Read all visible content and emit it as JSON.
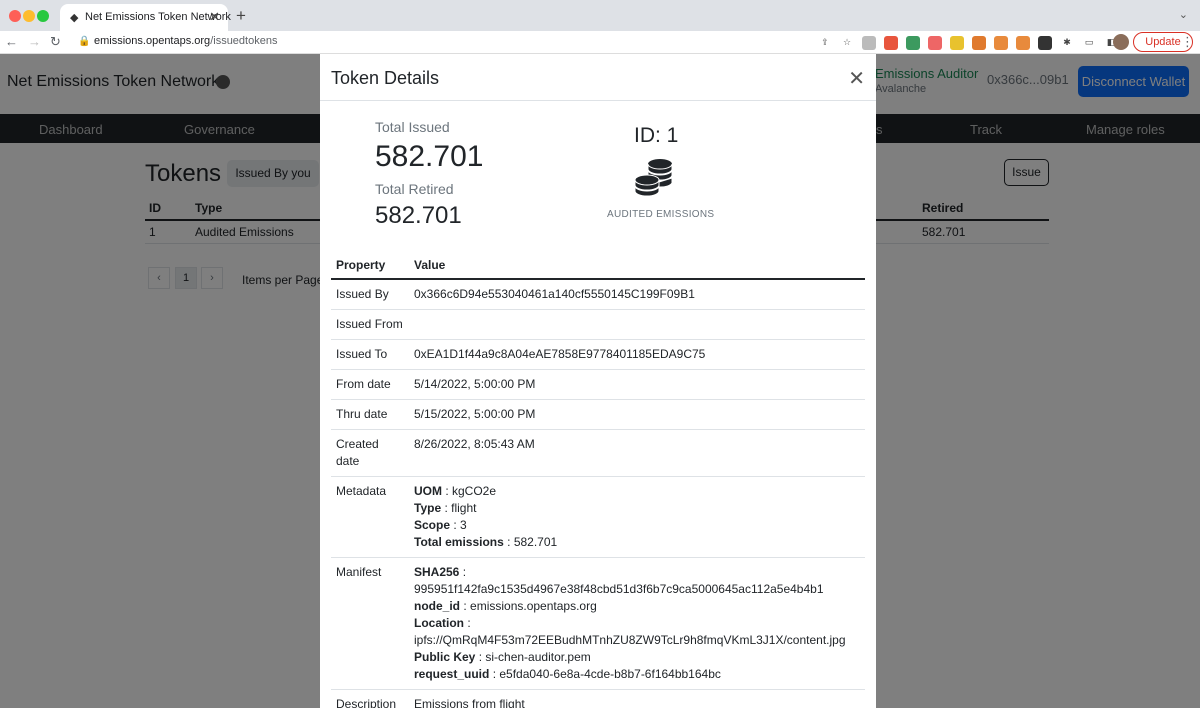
{
  "browser": {
    "tab_title": "Net Emissions Token Network",
    "url_host": "emissions.opentaps.org",
    "url_path": "/issuedtokens",
    "update_label": "Update"
  },
  "app": {
    "title": "Net Emissions Token Network",
    "role": "Emissions Auditor",
    "network": "Avalanche",
    "wallet": "0x366c...09b1",
    "disconnect_label": "Disconnect Wallet"
  },
  "nav": [
    {
      "label": "Dashboard"
    },
    {
      "label": "Governance"
    },
    {
      "label": "s"
    },
    {
      "label": "Track"
    },
    {
      "label": "Manage roles"
    }
  ],
  "tokens_page": {
    "heading": "Tokens",
    "filter_label": "Issued By you",
    "issue_label": "Issue",
    "headers": {
      "id": "ID",
      "type": "Type",
      "retired": "Retired"
    },
    "row": {
      "id": "1",
      "type": "Audited Emissions",
      "retired": "582.701"
    },
    "page": "1",
    "items_per_page": "Items per Page"
  },
  "modal": {
    "title": "Token Details",
    "total_issued_label": "Total Issued",
    "total_issued": "582.701",
    "total_retired_label": "Total Retired",
    "total_retired": "582.701",
    "token_id": "ID: 1",
    "token_type": "AUDITED EMISSIONS",
    "table_headers": {
      "property": "Property",
      "value": "Value"
    },
    "rows": {
      "issued_by": {
        "k": "Issued By",
        "v": "0x366c6D94e553040461a140cf5550145C199F09B1"
      },
      "issued_from": {
        "k": "Issued From",
        "v": ""
      },
      "issued_to": {
        "k": "Issued To",
        "v": "0xEA1D1f44a9c8A04eAE7858E9778401185EDA9C75"
      },
      "from_date": {
        "k": "From date",
        "v": "5/14/2022, 5:00:00 PM"
      },
      "thru_date": {
        "k": "Thru date",
        "v": "5/15/2022, 5:00:00 PM"
      },
      "created_date": {
        "k": "Created date",
        "v": "8/26/2022, 8:05:43 AM"
      },
      "metadata": {
        "k": "Metadata",
        "uom_k": "UOM",
        "uom_v": " : kgCO2e",
        "type_k": "Type",
        "type_v": " : flight",
        "scope_k": "Scope",
        "scope_v": " : 3",
        "total_k": "Total emissions",
        "total_v": " : 582.701"
      },
      "manifest": {
        "k": "Manifest",
        "sha_k": "SHA256",
        "sha_v": " : 995951f142fa9c1535d4967e38f48cbd51d3f6b7c9ca5000645ac112a5e4b4b1",
        "node_k": "node_id",
        "node_v": " : emissions.opentaps.org",
        "loc_k": "Location",
        "loc_v": " :",
        "loc_url": "ipfs://QmRqM4F53m72EEBudhMTnhZU8ZW9TcLr9h8fmqVKmL3J1X/content.jpg",
        "pk_k": "Public Key",
        "pk_v": " : si-chen-auditor.pem",
        "req_k": "request_uuid",
        "req_v": " : e5fda040-6e8a-4cde-b8b7-6f164bb164bc"
      },
      "description": {
        "k": "Description",
        "v": "Emissions from flight"
      }
    }
  }
}
